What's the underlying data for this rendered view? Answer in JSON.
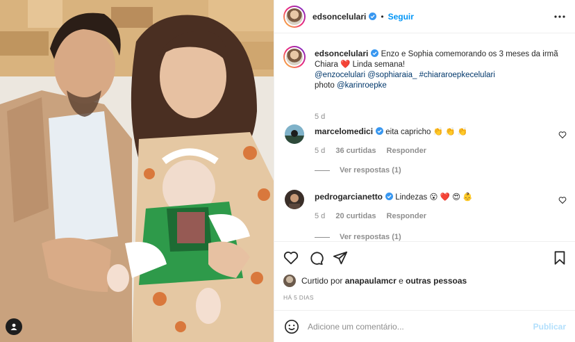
{
  "post": {
    "author": "edsoncelulari",
    "follow_label": "Seguir",
    "separator": "•",
    "caption": {
      "username": "edsoncelulari",
      "text_part1": "Enzo e Sophia comemorando os 3 meses da irmã Chiara",
      "heart": "❤️",
      "text_part2": "Linda semana!",
      "mention1": "@enzocelulari",
      "mention2": "@sophiaraia_",
      "hashtag": "#chiararoepkecelulari",
      "photo_label": "photo",
      "photo_mention": "@karinroepke",
      "time": "5 d"
    },
    "comments": [
      {
        "username": "marcelomedici",
        "text": "eita capricho",
        "emojis": "👏 👏 👏",
        "time": "5 d",
        "likes": "36 curtidas",
        "reply_label": "Responder",
        "replies_label": "Ver respostas (1)"
      },
      {
        "username": "pedrogarcianetto",
        "text": "Lindezas",
        "emojis": "😮 ❤️ 😍 👶",
        "time": "5 d",
        "likes": "20 curtidas",
        "reply_label": "Responder",
        "replies_label": "Ver respostas (1)"
      }
    ],
    "liked_by": {
      "prefix": "Curtido por",
      "user": "anapaulamcr",
      "connector": "e",
      "others": "outras pessoas"
    },
    "posted_ago": "HÁ 5 DIAS",
    "add_comment": {
      "placeholder": "Adicione um comentário...",
      "publish_label": "Publicar"
    }
  },
  "icons": {
    "header": [
      "verified-badge-icon",
      "more-options-icon"
    ],
    "actions": [
      "heart-icon",
      "comment-icon",
      "share-icon",
      "bookmark-icon"
    ],
    "composer": [
      "emoji-icon"
    ],
    "photo": [
      "user-tag-icon"
    ]
  },
  "colors": {
    "accent_blue": "#0095f6",
    "publish_disabled": "#b2dffc",
    "verified": "#3897f0",
    "muted_text": "#8e8e8e",
    "link": "#00376b"
  }
}
